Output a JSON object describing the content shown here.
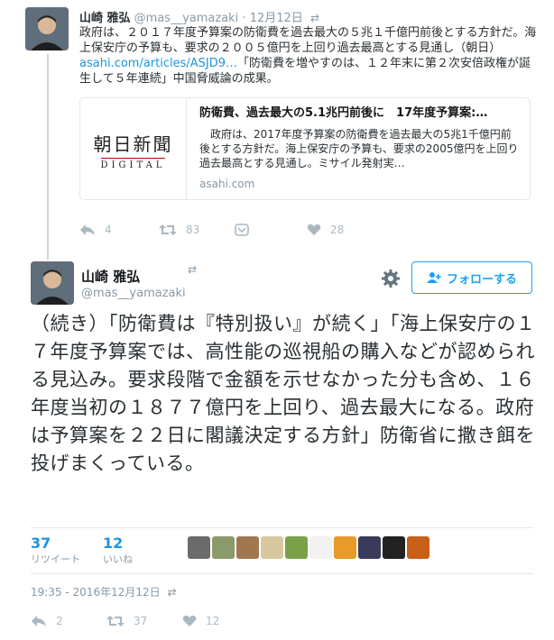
{
  "tweet1": {
    "name": "山崎 雅弘",
    "handle": "@mas__yamazaki",
    "separator": "·",
    "date": "12月12日",
    "text_before_link": "政府は、２０１７年度予算案の防衛費を過去最大の５兆１千億円前後とする方針だ。海上保安庁の予算も、要求の２００５億円を上回り過去最高とする見通し（朝日）",
    "link": "asahi.com/articles/ASJD9…",
    "text_after_link": "「防衛費を増やすのは、１２年末に第２次安倍政権が誕生して５年連続」中国脅威論の成果。",
    "card": {
      "logo_kanji": "朝日新聞",
      "logo_sub": "DIGITAL",
      "title": "防衛費、過去最大の5.1兆円前後に　17年度予算案:…",
      "description": "　政府は、2017年度予算案の防衛費を過去最大の5兆1千億円前後とする方針だ。海上保安庁の予算も、要求の2005億円を上回り過去最高とする見通し。ミサイル発射実…",
      "domain": "asahi.com"
    },
    "actions": {
      "reply": "4",
      "retweet": "83",
      "like": "28"
    }
  },
  "tweet2": {
    "name": "山崎 雅弘",
    "handle": "@mas__yamazaki",
    "follow_label": "フォローする",
    "text": "（続き）「防衛費は『特別扱い』が続く」「海上保安庁の１７年度予算案では、高性能の巡視船の購入などが認められる見込み。要求段階で金額を示せなかった分も含め、１６年度当初の１８７７億円を上回り、過去最大になる。政府は予算案を２２日に閣議決定する方針」防衛省に撒き餌を投げまくっている。",
    "stats": {
      "retweets": "37",
      "retweets_label": "リツイート",
      "likes": "12",
      "likes_label": "いいね"
    },
    "liker_colors": [
      "#6b6b6b",
      "#8a9a6a",
      "#a07850",
      "#d8c8a0",
      "#7aa04a",
      "#f2f2f2",
      "#e89a2a",
      "#3a3a5a",
      "#222222",
      "#c8601a"
    ],
    "timestamp": "19:35 - 2016年12月12日",
    "actions": {
      "reply": "2",
      "retweet": "37",
      "like": "12"
    }
  },
  "colors": {
    "link": "#1b95e0",
    "muted": "#8899a6",
    "follow": "#1da1f2"
  }
}
